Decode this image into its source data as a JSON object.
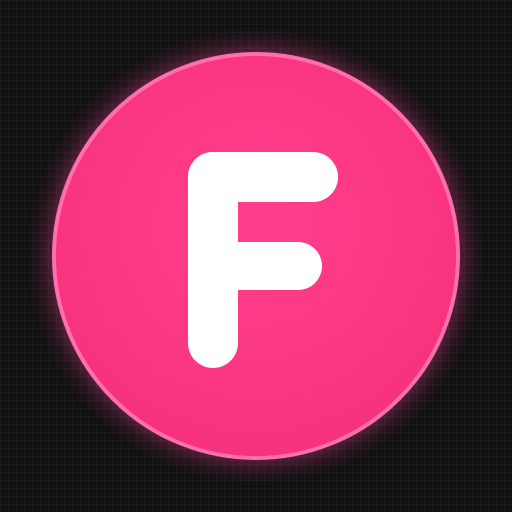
{
  "icon": {
    "letter": "F",
    "colors": {
      "background": "#111112",
      "circle_fill": "#f9357f",
      "circle_border": "#ff6fb0",
      "letter_fill": "#ffffff"
    }
  }
}
